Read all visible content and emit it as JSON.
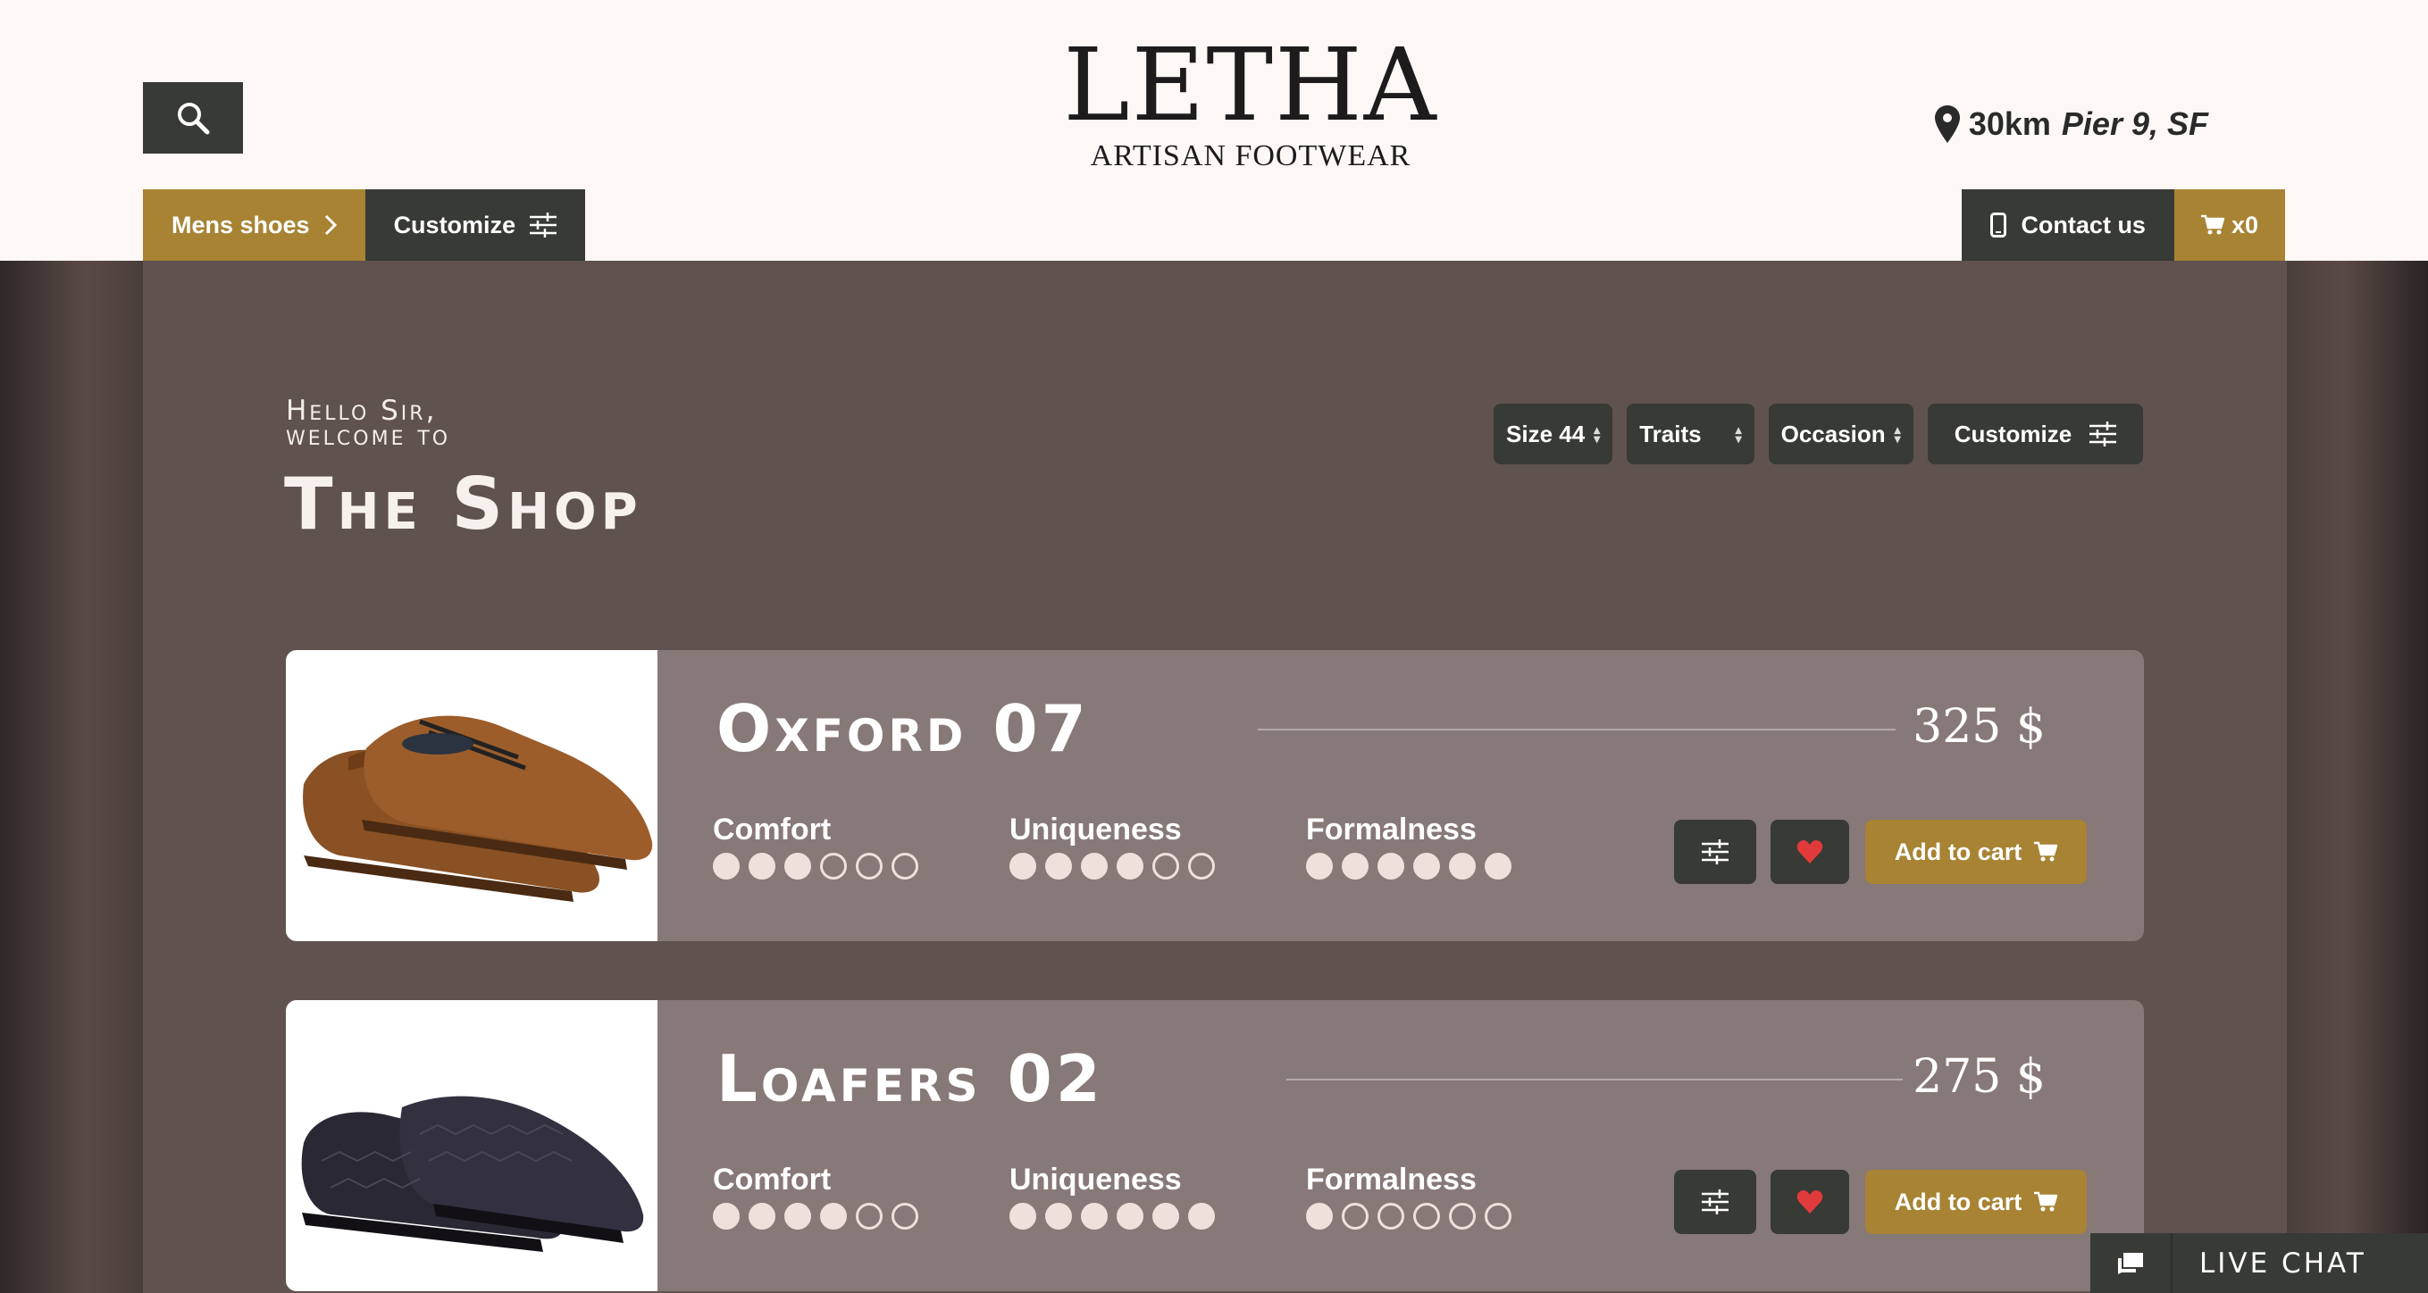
{
  "brand": {
    "name": "LETHA",
    "tagline": "ARTISAN FOOTWEAR"
  },
  "header": {
    "distance": "30km",
    "place": "Pier 9, SF",
    "nav_left": [
      {
        "label": "Mens shoes",
        "icon": "chevron-right-icon"
      },
      {
        "label": "Customize",
        "icon": "sliders-icon"
      }
    ],
    "nav_right": [
      {
        "label": "Contact us",
        "icon": "phone-icon"
      },
      {
        "label": "x0",
        "icon": "cart-icon"
      }
    ]
  },
  "hero": {
    "greeting_line1": "Hello Sir,",
    "greeting_line2": "welcome to",
    "title": "The Shop"
  },
  "filters": {
    "size": "Size 44",
    "traits": "Traits",
    "occasion": "Occasion",
    "customize": "Customize"
  },
  "products": [
    {
      "name": "Oxford 07",
      "price": "325 $",
      "attributes": [
        {
          "label": "Comfort",
          "rating": 3,
          "max": 6
        },
        {
          "label": "Uniqueness",
          "rating": 4,
          "max": 6
        },
        {
          "label": "Formalness",
          "rating": 6,
          "max": 6
        }
      ],
      "add_label": "Add to cart",
      "image": "brown-oxford-shoes"
    },
    {
      "name": "Loafers 02",
      "price": "275 $",
      "attributes": [
        {
          "label": "Comfort",
          "rating": 4,
          "max": 6
        },
        {
          "label": "Uniqueness",
          "rating": 6,
          "max": 6
        },
        {
          "label": "Formalness",
          "rating": 1,
          "max": 6
        }
      ],
      "add_label": "Add to cart",
      "image": "black-crocodile-loafers"
    }
  ],
  "live_chat": {
    "label": "LIVE CHAT"
  },
  "colors": {
    "gold": "#a78333",
    "dark": "#383a35",
    "panel": "#5f524f",
    "card": "#877978",
    "heart": "#e03a3a"
  }
}
